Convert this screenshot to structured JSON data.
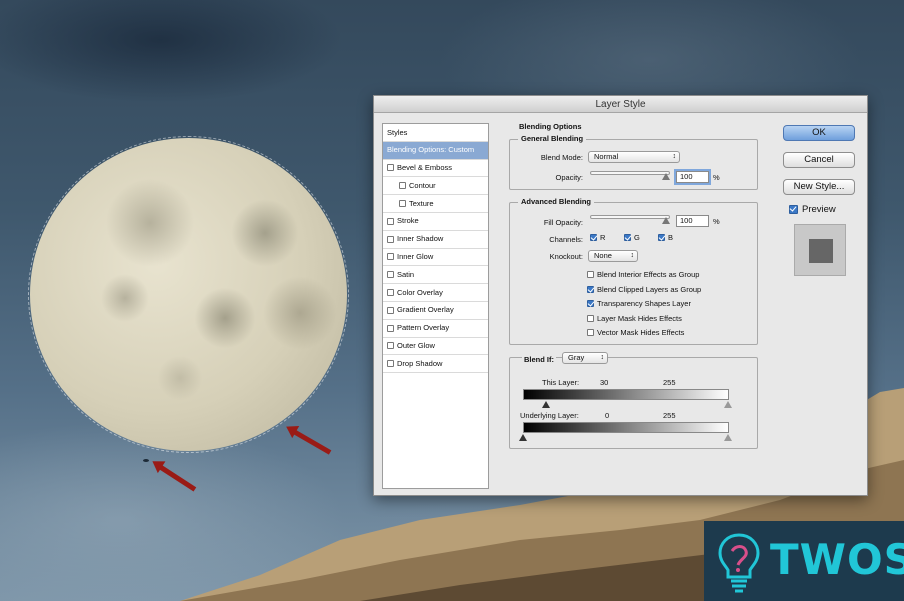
{
  "dialog": {
    "title": "Layer Style",
    "styles_header": "Styles",
    "styles": [
      {
        "label": "Blending Options: Custom",
        "selected": true,
        "checkbox": false,
        "checked": false,
        "indent": false
      },
      {
        "label": "Bevel & Emboss",
        "selected": false,
        "checkbox": true,
        "checked": false,
        "indent": false
      },
      {
        "label": "Contour",
        "selected": false,
        "checkbox": true,
        "checked": false,
        "indent": true
      },
      {
        "label": "Texture",
        "selected": false,
        "checkbox": true,
        "checked": false,
        "indent": true
      },
      {
        "label": "Stroke",
        "selected": false,
        "checkbox": true,
        "checked": false,
        "indent": false
      },
      {
        "label": "Inner Shadow",
        "selected": false,
        "checkbox": true,
        "checked": false,
        "indent": false
      },
      {
        "label": "Inner Glow",
        "selected": false,
        "checkbox": true,
        "checked": false,
        "indent": false
      },
      {
        "label": "Satin",
        "selected": false,
        "checkbox": true,
        "checked": false,
        "indent": false
      },
      {
        "label": "Color Overlay",
        "selected": false,
        "checkbox": true,
        "checked": false,
        "indent": false
      },
      {
        "label": "Gradient Overlay",
        "selected": false,
        "checkbox": true,
        "checked": false,
        "indent": false
      },
      {
        "label": "Pattern Overlay",
        "selected": false,
        "checkbox": true,
        "checked": false,
        "indent": false
      },
      {
        "label": "Outer Glow",
        "selected": false,
        "checkbox": true,
        "checked": false,
        "indent": false
      },
      {
        "label": "Drop Shadow",
        "selected": false,
        "checkbox": true,
        "checked": false,
        "indent": false
      }
    ],
    "blending_options_title": "Blending Options",
    "general": {
      "title": "General Blending",
      "blend_mode_label": "Blend Mode:",
      "blend_mode_value": "Normal",
      "opacity_label": "Opacity:",
      "opacity_value": "100",
      "opacity_unit": "%",
      "opacity_fraction": 1.0
    },
    "advanced": {
      "title": "Advanced Blending",
      "fill_opacity_label": "Fill Opacity:",
      "fill_opacity_value": "100",
      "fill_opacity_unit": "%",
      "fill_opacity_fraction": 1.0,
      "channels_label": "Channels:",
      "channels": [
        {
          "label": "R",
          "checked": true
        },
        {
          "label": "G",
          "checked": true
        },
        {
          "label": "B",
          "checked": true
        }
      ],
      "knockout_label": "Knockout:",
      "knockout_value": "None",
      "options": [
        {
          "label": "Blend Interior Effects as Group",
          "checked": false
        },
        {
          "label": "Blend Clipped Layers as Group",
          "checked": true
        },
        {
          "label": "Transparency Shapes Layer",
          "checked": true
        },
        {
          "label": "Layer Mask Hides Effects",
          "checked": false
        },
        {
          "label": "Vector Mask Hides Effects",
          "checked": false
        }
      ]
    },
    "blend_if": {
      "label": "Blend If:",
      "value": "Gray",
      "this_layer_label": "This Layer:",
      "this_layer_low": "30",
      "this_layer_high": "255",
      "underlying_label": "Underlying Layer:",
      "underlying_low": "0",
      "underlying_high": "255"
    },
    "buttons": {
      "ok": "OK",
      "cancel": "Cancel",
      "new_style": "New Style..."
    },
    "preview": {
      "label": "Preview",
      "checked": true
    }
  },
  "logo": {
    "text": "TWOS",
    "icon": "lightbulb-icon"
  },
  "colors": {
    "accent": "#3b78c6",
    "selected": "#8aa9d3",
    "logo_text": "#21c6d7",
    "arrow": "#9a1b16"
  }
}
